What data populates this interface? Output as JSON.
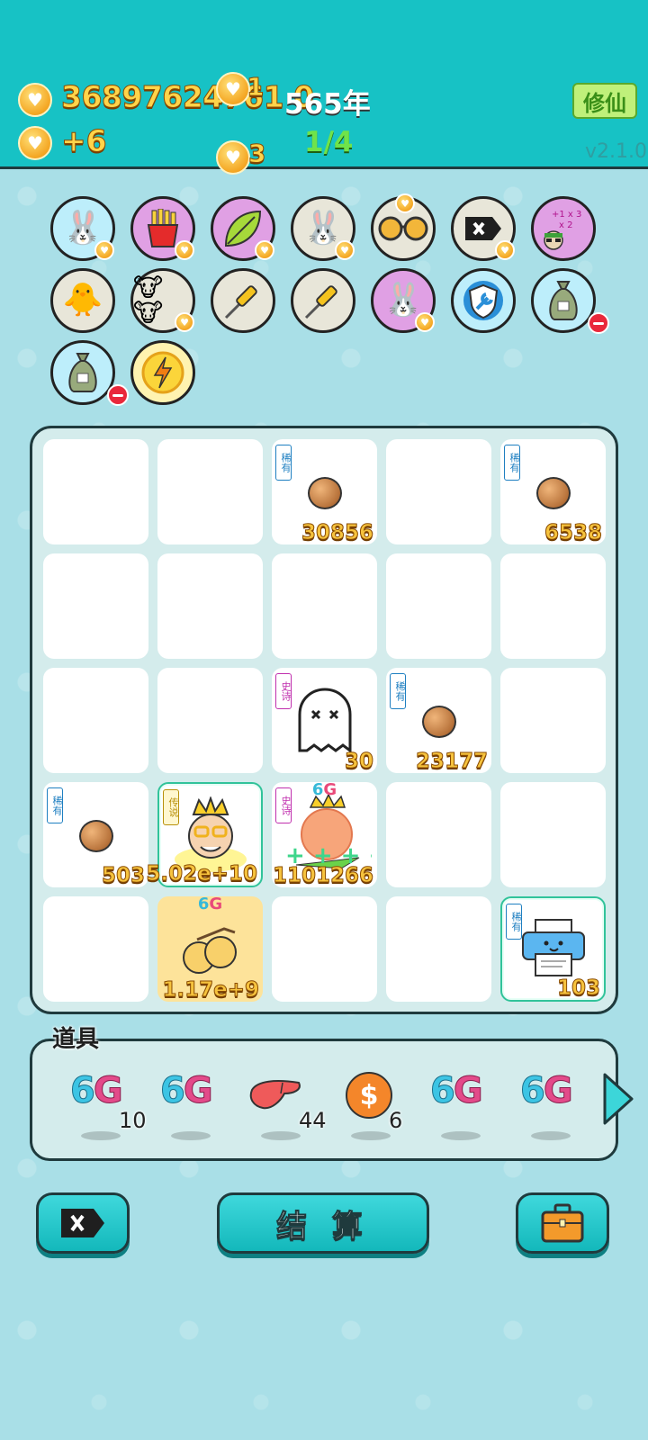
{
  "header": {
    "gold_amount": "36897624761 0",
    "gold_per_tick": "+6",
    "float_gain_top": "1",
    "float_gain_bottom": "3",
    "year": "565年",
    "progress": "1/4",
    "cultivate_button": "修仙",
    "version": "v2.1.0"
  },
  "items": [
    {
      "name": "rabbit",
      "bg": "#bdeefb"
    },
    {
      "name": "fries",
      "bg": "#e0a0e4"
    },
    {
      "name": "leaf",
      "bg": "#e0a0e4"
    },
    {
      "name": "rabbit",
      "bg": "#e8e6d9"
    },
    {
      "name": "glasses",
      "bg": "#e8e6d9"
    },
    {
      "name": "delete-tag",
      "bg": "#e8e6d9"
    },
    {
      "name": "notes",
      "bg": "#e0a0e4"
    },
    {
      "name": "chick",
      "bg": "#e8e6d9"
    },
    {
      "name": "cows",
      "bg": "#e8e6d9"
    },
    {
      "name": "screwdriver",
      "bg": "#e8e6d9"
    },
    {
      "name": "screwdriver",
      "bg": "#e8e6d9"
    },
    {
      "name": "rabbit",
      "bg": "#e0a0e4"
    },
    {
      "name": "shield-wrench",
      "bg": "#bdeefb"
    },
    {
      "name": "money-bag",
      "bg": "#bdeefb"
    },
    {
      "name": "money-bag",
      "bg": "#bdeefb"
    },
    {
      "name": "lightning",
      "bg": "#fff3b0"
    }
  ],
  "tags": {
    "rare": "稀有",
    "epic": "史诗",
    "legend": "传说"
  },
  "board": {
    "cells": [
      {
        "row": 0,
        "col": 2,
        "tag": "rare",
        "kind": "seed",
        "value": "30856"
      },
      {
        "row": 0,
        "col": 4,
        "tag": "rare",
        "kind": "seed",
        "value": "6538"
      },
      {
        "row": 2,
        "col": 2,
        "tag": "epic",
        "kind": "ghost",
        "value": "30"
      },
      {
        "row": 2,
        "col": 3,
        "tag": "rare",
        "kind": "seed",
        "value": "23177"
      },
      {
        "row": 3,
        "col": 0,
        "tag": "rare",
        "kind": "seed",
        "value": "503"
      },
      {
        "row": 3,
        "col": 1,
        "tag": "legend",
        "kind": "king",
        "value": "5.02e+10"
      },
      {
        "row": 3,
        "col": 2,
        "tag": "epic",
        "kind": "peach",
        "value": "1101266",
        "tier": "6G"
      },
      {
        "row": 4,
        "col": 1,
        "tag": "",
        "kind": "fruit",
        "value": "1.17e+9",
        "tier": "6G"
      },
      {
        "row": 4,
        "col": 4,
        "tag": "rare",
        "kind": "printer",
        "value": "103"
      }
    ]
  },
  "props": {
    "title": "道具",
    "list": [
      {
        "kind": "6g",
        "label": "6G",
        "count": "10"
      },
      {
        "kind": "6g",
        "label": "6G",
        "count": ""
      },
      {
        "kind": "liver",
        "label": "",
        "count": "44"
      },
      {
        "kind": "coin",
        "label": "",
        "count": "6"
      },
      {
        "kind": "6g",
        "label": "6G",
        "count": ""
      },
      {
        "kind": "6g",
        "label": "6G",
        "count": ""
      }
    ]
  },
  "buttons": {
    "settle": "结 算"
  }
}
